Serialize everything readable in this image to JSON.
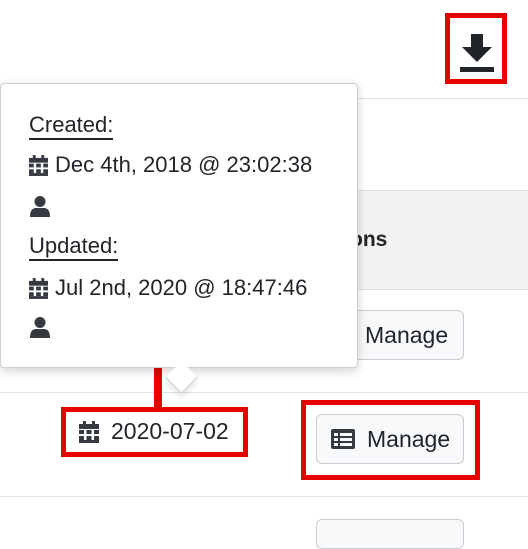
{
  "toolbar": {
    "download_icon": "download-icon"
  },
  "table": {
    "actions_header_partial": "ons",
    "rows": [
      {
        "manage_label": "Manage"
      },
      {
        "date": "2020-07-02",
        "manage_label": "Manage",
        "manage_icon": "list-icon"
      }
    ]
  },
  "popover": {
    "created_label": "Created:",
    "created_value": "Dec 4th, 2018 @ 23:02:38",
    "updated_label": "Updated:",
    "updated_value": "Jul 2nd, 2020 @ 18:47:46",
    "icons": [
      "calendar-icon",
      "user-icon"
    ]
  },
  "annotation_color": "#e60000"
}
